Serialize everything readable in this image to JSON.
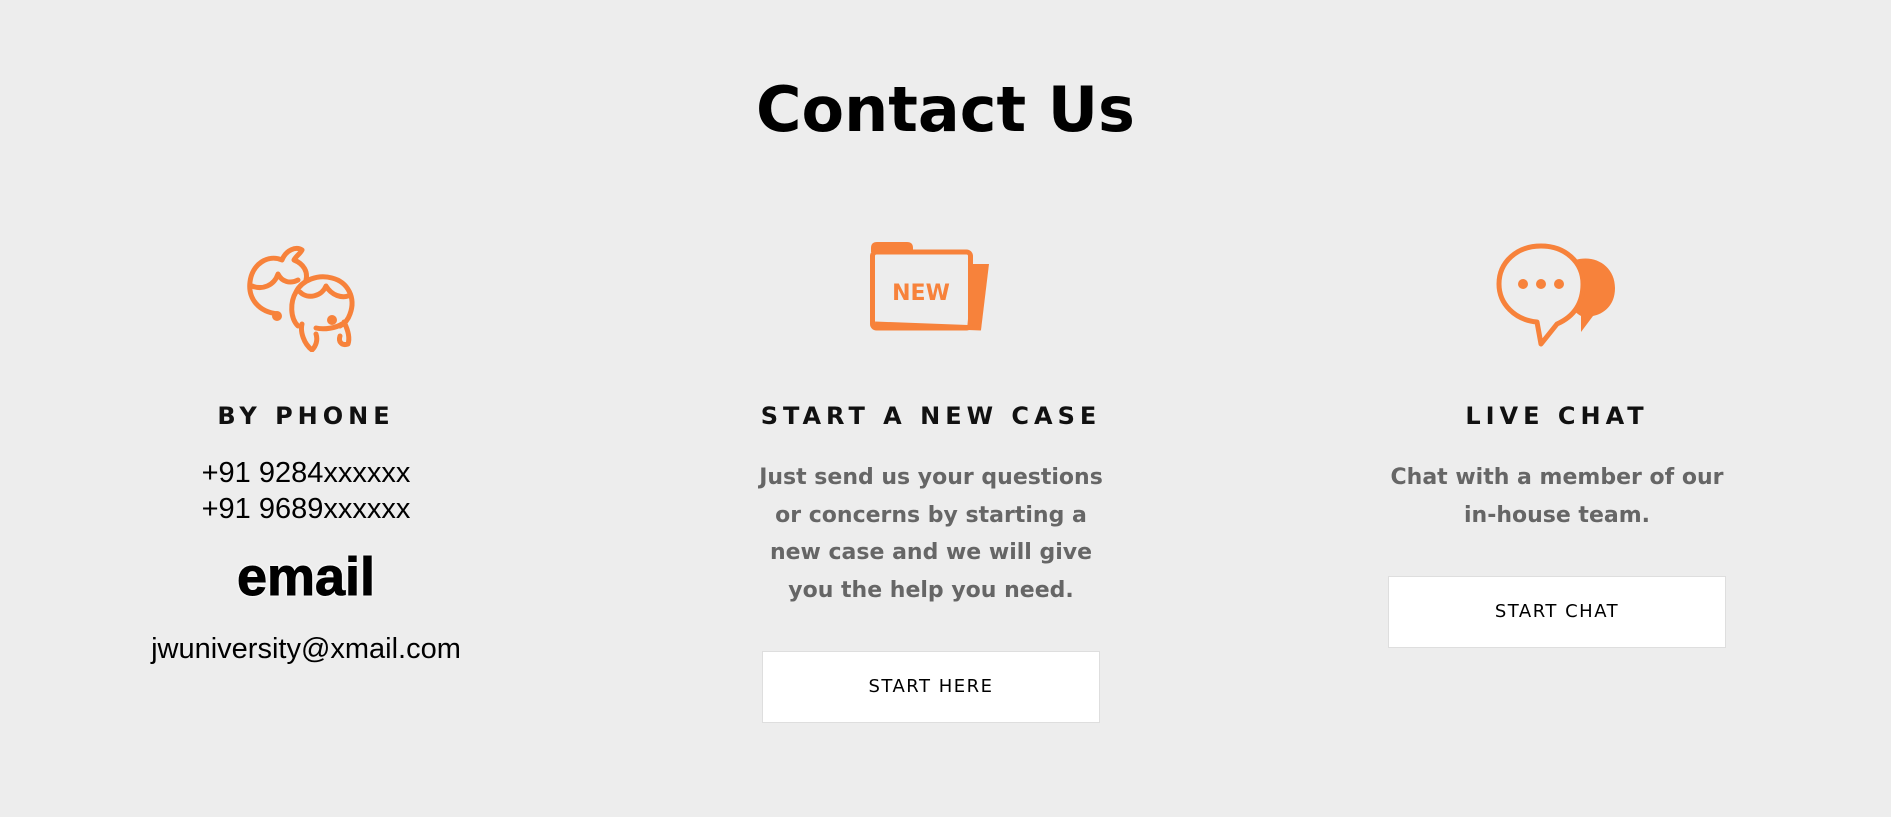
{
  "page": {
    "title": "Contact Us"
  },
  "colors": {
    "accent": "#f7823b",
    "background": "#ededed",
    "description_text": "#666666",
    "button_bg": "#ffffff"
  },
  "phone": {
    "icon": "support-agents-icon",
    "heading": "BY PHONE",
    "numbers": [
      "+91 9284xxxxxx",
      "+91 9689xxxxxx"
    ],
    "email_heading": "email",
    "email": "jwuniversity@xmail.com"
  },
  "new_case": {
    "icon": "new-folder-icon",
    "icon_text": "NEW",
    "heading": "START A NEW CASE",
    "description": "Just send us your questions or concerns by starting a new case and we will give you the help you need.",
    "button_label": "START HERE"
  },
  "live_chat": {
    "icon": "chat-bubbles-icon",
    "heading": "LIVE CHAT",
    "description": "Chat with a member of our in-house team.",
    "button_label": "START CHAT"
  }
}
